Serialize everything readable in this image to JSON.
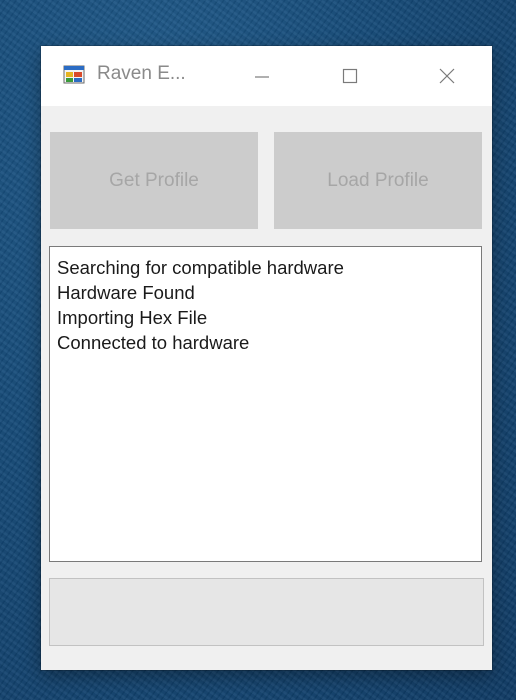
{
  "window": {
    "title": "Raven E..."
  },
  "titlebar_icons": {
    "app": "app-window-icon",
    "minimize": "minimize-icon",
    "maximize": "maximize-icon",
    "close": "close-icon"
  },
  "buttons": {
    "get_profile": "Get Profile",
    "load_profile": "Load Profile",
    "enabled": false
  },
  "log": {
    "lines": [
      "Searching for compatible hardware",
      "Hardware Found",
      "Importing Hex File",
      "Connected to hardware"
    ]
  },
  "status_bar": {
    "text": ""
  },
  "colors": {
    "desktop": "#154a78",
    "window_bg": "#f0f0f0",
    "button_disabled_bg": "#cccccc",
    "button_disabled_text": "#a6a6a6"
  }
}
